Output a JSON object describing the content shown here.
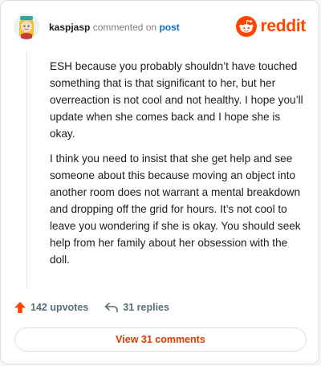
{
  "header": {
    "username": "kaspjasp",
    "action_text": "commented on",
    "link_text": "post"
  },
  "logo": {
    "wordmark": "reddit",
    "icon": "reddit-snoo-icon",
    "color": "#ff4500"
  },
  "comment": {
    "paragraphs": [
      "ESH because you probably shouldn’t have touched something that is that significant to her, but her overreaction is not cool and not healthy. I hope you’ll update when she comes back and I hope she is okay.",
      "I think you need to insist that she get help and see someone about this because moving an object into another room does not warrant a mental breakdown and dropping off the grid for hours. It’s not cool to leave you wondering if she is okay. You should seek help from her family about her obsession with the doll."
    ]
  },
  "actions": {
    "upvotes": "142 upvotes",
    "upvote_icon": "upvote-arrow-icon",
    "upvote_color": "#ff4500",
    "replies": "31 replies",
    "reply_icon": "reply-arrow-icon"
  },
  "view_comments": {
    "label": "View 31 comments",
    "color": "#d93a00"
  }
}
